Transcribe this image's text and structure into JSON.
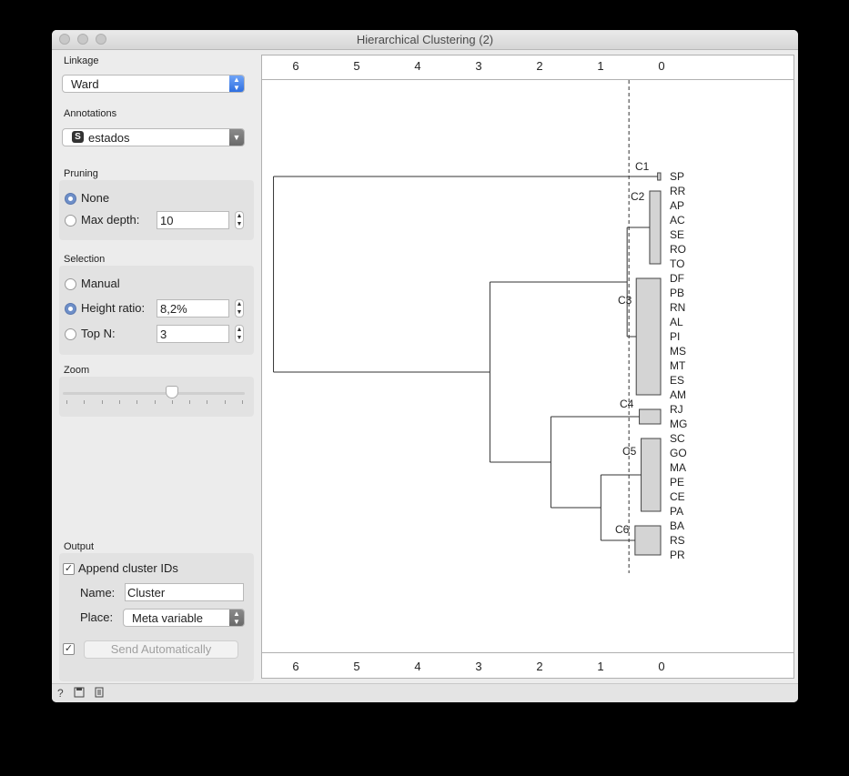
{
  "window": {
    "title": "Hierarchical Clustering (2)"
  },
  "linkage": {
    "label": "Linkage",
    "value": "Ward"
  },
  "annotations": {
    "label": "Annotations",
    "value": "estados",
    "type_badge": "S"
  },
  "pruning": {
    "label": "Pruning",
    "none_label": "None",
    "max_depth_label": "Max depth:",
    "max_depth_value": "10",
    "selected": "None"
  },
  "selection": {
    "label": "Selection",
    "manual_label": "Manual",
    "height_ratio_label": "Height ratio:",
    "height_ratio_value": "8,2%",
    "top_n_label": "Top N:",
    "top_n_value": "3",
    "selected": "Height ratio"
  },
  "zoom": {
    "label": "Zoom",
    "level": 0.6
  },
  "output": {
    "label": "Output",
    "append_label": "Append cluster IDs",
    "append_checked": true,
    "name_label": "Name:",
    "name_value": "Cluster",
    "place_label": "Place:",
    "place_value": "Meta variable",
    "auto_checked": true,
    "send_label": "Send Automatically"
  },
  "axis": {
    "ticks": [
      "6",
      "5",
      "4",
      "3",
      "2",
      "1",
      "0"
    ]
  },
  "dendrogram": {
    "leaves": [
      "SP",
      "RR",
      "AP",
      "AC",
      "SE",
      "RO",
      "TO",
      "DF",
      "PB",
      "RN",
      "AL",
      "PI",
      "MS",
      "MT",
      "ES",
      "AM",
      "RJ",
      "MG",
      "SC",
      "GO",
      "MA",
      "PE",
      "CE",
      "PA",
      "BA",
      "RS",
      "PR"
    ],
    "clusters": [
      "C1",
      "C2",
      "C3",
      "C4",
      "C5",
      "C6"
    ],
    "cut_height": 0.52
  },
  "statusbar": {
    "icons": [
      "help-icon",
      "save-icon",
      "report-icon"
    ]
  }
}
